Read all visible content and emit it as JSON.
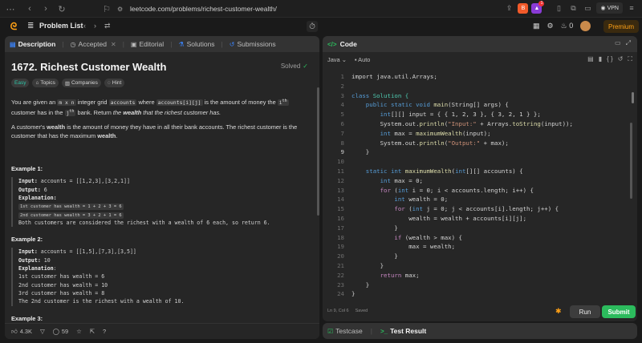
{
  "browser": {
    "url": "leetcode.com/problems/richest-customer-wealth/",
    "vpn_label": "VPN",
    "notif_count": "1"
  },
  "header": {
    "problem_list_label": "Problem List",
    "premium_label": "Premium",
    "fire_count": "0"
  },
  "left_tabs": [
    {
      "label": "Description"
    },
    {
      "label": "Accepted"
    },
    {
      "label": "Editorial"
    },
    {
      "label": "Solutions"
    },
    {
      "label": "Submissions"
    }
  ],
  "problem": {
    "title": "1672. Richest Customer Wealth",
    "status": "Solved",
    "chips": [
      "Easy",
      "Topics",
      "Companies",
      "Hint"
    ],
    "desc": {
      "p1_a": "You are given an ",
      "p1_code1": "m x n",
      "p1_b": " integer grid ",
      "p1_code2": "accounts",
      "p1_c": " where ",
      "p1_code3": "accounts[i][j]",
      "p1_d": " is the amount of money the ",
      "p1_code4": "i",
      "p1_sup1": "th",
      "p1_e": " customer has in the ",
      "p1_code5": "j",
      "p1_sup2": "th",
      "p1_f": " bank. Return ",
      "p1_g": "the ",
      "p1_g_bold": "wealth",
      "p1_h": " that the richest customer has.",
      "p2_a": "A customer's ",
      "p2_bold1": "wealth",
      "p2_b": " is the amount of money they have in all their bank accounts. The richest customer is the customer that has the maximum ",
      "p2_bold2": "wealth",
      "p2_c": "."
    },
    "examples": [
      {
        "heading": "Example 1:",
        "input_label": "Input:",
        "input": " accounts = [[1,2,3],[3,2,1]]",
        "output_label": "Output:",
        "output": " 6",
        "explanation_label": "Explanation:",
        "boxes": [
          "1st customer has wealth = 1 + 2 + 3 = 6",
          "2nd customer has wealth = 3 + 2 + 1 = 6"
        ],
        "lines": [
          "Both customers are considered the richest with a wealth of 6 each, so return 6."
        ]
      },
      {
        "heading": "Example 2:",
        "input_label": "Input:",
        "input": " accounts = [[1,5],[7,3],[3,5]]",
        "output_label": "Output:",
        "output": " 10",
        "explanation_label": "Explanation",
        "explanation_suffix": ":",
        "lines": [
          "1st customer has wealth = 6",
          "2nd customer has wealth = 10",
          "3rd customer has wealth = 8",
          "The 2nd customer is the richest with a wealth of 10."
        ]
      },
      {
        "heading": "Example 3:"
      }
    ]
  },
  "left_footer": {
    "likes": "4.3K",
    "comments": "59"
  },
  "code_panel": {
    "title": "Code",
    "language": "Java",
    "auto_label": "Auto",
    "status_pos": "Ln 9, Col 6",
    "status_saved": "Saved",
    "run_label": "Run",
    "submit_label": "Submit"
  },
  "code_lines": [
    [
      {
        "t": "import java.util.Arrays;",
        "c": "#d4d4d4"
      }
    ],
    [],
    [
      {
        "t": "class ",
        "c": "#569cd6"
      },
      {
        "t": "Solution {",
        "c": "#4ec9b0"
      }
    ],
    [
      {
        "t": "    public static void ",
        "c": "#569cd6"
      },
      {
        "t": "main",
        "c": "#dcdcaa"
      },
      {
        "t": "(String[] args) {",
        "c": "#d4d4d4"
      }
    ],
    [
      {
        "t": "        int",
        "c": "#569cd6"
      },
      {
        "t": "[][] input = { { 1, 2, 3 }, { 3, 2, 1 } };",
        "c": "#d4d4d4"
      }
    ],
    [
      {
        "t": "        System.out.",
        "c": "#d4d4d4"
      },
      {
        "t": "println",
        "c": "#dcdcaa"
      },
      {
        "t": "(",
        "c": "#d4d4d4"
      },
      {
        "t": "\"Input:\"",
        "c": "#ce9178"
      },
      {
        "t": " + Arrays.",
        "c": "#d4d4d4"
      },
      {
        "t": "toString",
        "c": "#dcdcaa"
      },
      {
        "t": "(input));",
        "c": "#d4d4d4"
      }
    ],
    [
      {
        "t": "        int ",
        "c": "#569cd6"
      },
      {
        "t": "max = ",
        "c": "#d4d4d4"
      },
      {
        "t": "maximumWealth",
        "c": "#dcdcaa"
      },
      {
        "t": "(input);",
        "c": "#d4d4d4"
      }
    ],
    [
      {
        "t": "        System.out.",
        "c": "#d4d4d4"
      },
      {
        "t": "println",
        "c": "#dcdcaa"
      },
      {
        "t": "(",
        "c": "#d4d4d4"
      },
      {
        "t": "\"Output:\"",
        "c": "#ce9178"
      },
      {
        "t": " + max);",
        "c": "#d4d4d4"
      }
    ],
    [
      {
        "t": "    }",
        "c": "#d4d4d4"
      }
    ],
    [],
    [
      {
        "t": "    static int ",
        "c": "#569cd6"
      },
      {
        "t": "maximumWealth",
        "c": "#dcdcaa"
      },
      {
        "t": "(",
        "c": "#d4d4d4"
      },
      {
        "t": "int",
        "c": "#569cd6"
      },
      {
        "t": "[][] accounts) {",
        "c": "#d4d4d4"
      }
    ],
    [
      {
        "t": "        int ",
        "c": "#569cd6"
      },
      {
        "t": "max = 0;",
        "c": "#d4d4d4"
      }
    ],
    [
      {
        "t": "        for ",
        "c": "#c586c0"
      },
      {
        "t": "(",
        "c": "#d4d4d4"
      },
      {
        "t": "int ",
        "c": "#569cd6"
      },
      {
        "t": "i = 0; i < accounts.length; i++) {",
        "c": "#d4d4d4"
      }
    ],
    [
      {
        "t": "            int ",
        "c": "#569cd6"
      },
      {
        "t": "wealth = 0;",
        "c": "#d4d4d4"
      }
    ],
    [
      {
        "t": "            for ",
        "c": "#c586c0"
      },
      {
        "t": "(",
        "c": "#d4d4d4"
      },
      {
        "t": "int ",
        "c": "#569cd6"
      },
      {
        "t": "j = 0; j < accounts[i].length; j++) {",
        "c": "#d4d4d4"
      }
    ],
    [
      {
        "t": "                wealth = wealth + accounts[i][j];",
        "c": "#d4d4d4"
      }
    ],
    [
      {
        "t": "            }",
        "c": "#d4d4d4"
      }
    ],
    [
      {
        "t": "            if ",
        "c": "#c586c0"
      },
      {
        "t": "(wealth > max) {",
        "c": "#d4d4d4"
      }
    ],
    [
      {
        "t": "                max = wealth;",
        "c": "#d4d4d4"
      }
    ],
    [
      {
        "t": "            }",
        "c": "#d4d4d4"
      }
    ],
    [
      {
        "t": "        }",
        "c": "#d4d4d4"
      }
    ],
    [
      {
        "t": "        return ",
        "c": "#c586c0"
      },
      {
        "t": "max;",
        "c": "#d4d4d4"
      }
    ],
    [
      {
        "t": "    }",
        "c": "#d4d4d4"
      }
    ],
    [
      {
        "t": "}",
        "c": "#d4d4d4"
      }
    ]
  ],
  "current_line": 9,
  "bottom_tabs": [
    {
      "label": "Testcase"
    },
    {
      "label": "Test Result"
    }
  ]
}
